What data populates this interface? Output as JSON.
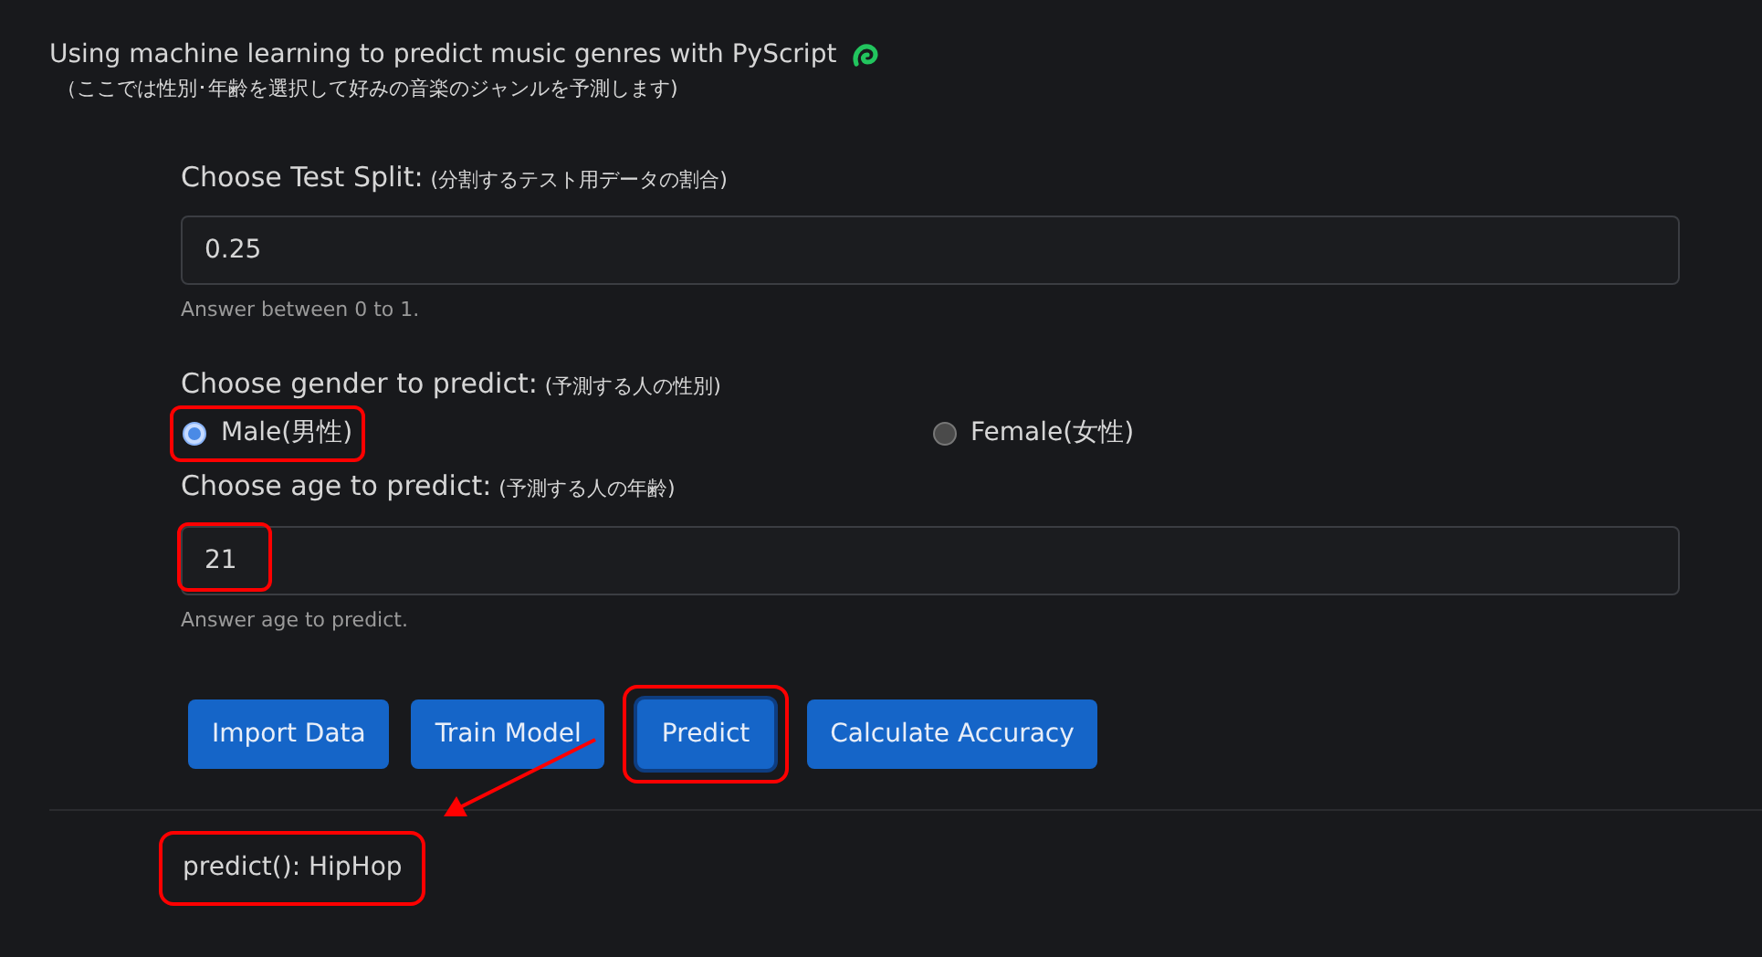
{
  "header": {
    "title": "Using machine learning to predict music genres with PyScript",
    "subtitle": "（ここでは性別･年齢を選択して好みの音楽のジャンルを予測します)"
  },
  "split": {
    "label": "Choose Test Split:",
    "label_note": "(分割するテスト用データの割合)",
    "value": "0.25",
    "hint": "Answer between 0 to 1."
  },
  "gender": {
    "label": "Choose gender to predict:",
    "label_note": "(予測する人の性別)",
    "options": [
      {
        "label": "Male(男性)",
        "selected": true,
        "highlighted": true
      },
      {
        "label": "Female(女性)",
        "selected": false,
        "highlighted": false
      }
    ]
  },
  "age": {
    "label": "Choose age to predict:",
    "label_note": "(予測する人の年齢)",
    "value": "21",
    "highlighted": true,
    "hint": "Answer age to predict."
  },
  "buttons": [
    {
      "label": "Import Data",
      "focused": false,
      "highlighted": false
    },
    {
      "label": "Train Model",
      "focused": false,
      "highlighted": false
    },
    {
      "label": "Predict",
      "focused": true,
      "highlighted": true
    },
    {
      "label": "Calculate Accuracy",
      "focused": false,
      "highlighted": false
    }
  ],
  "result": {
    "text": "predict(): HipHop",
    "highlighted": true
  }
}
